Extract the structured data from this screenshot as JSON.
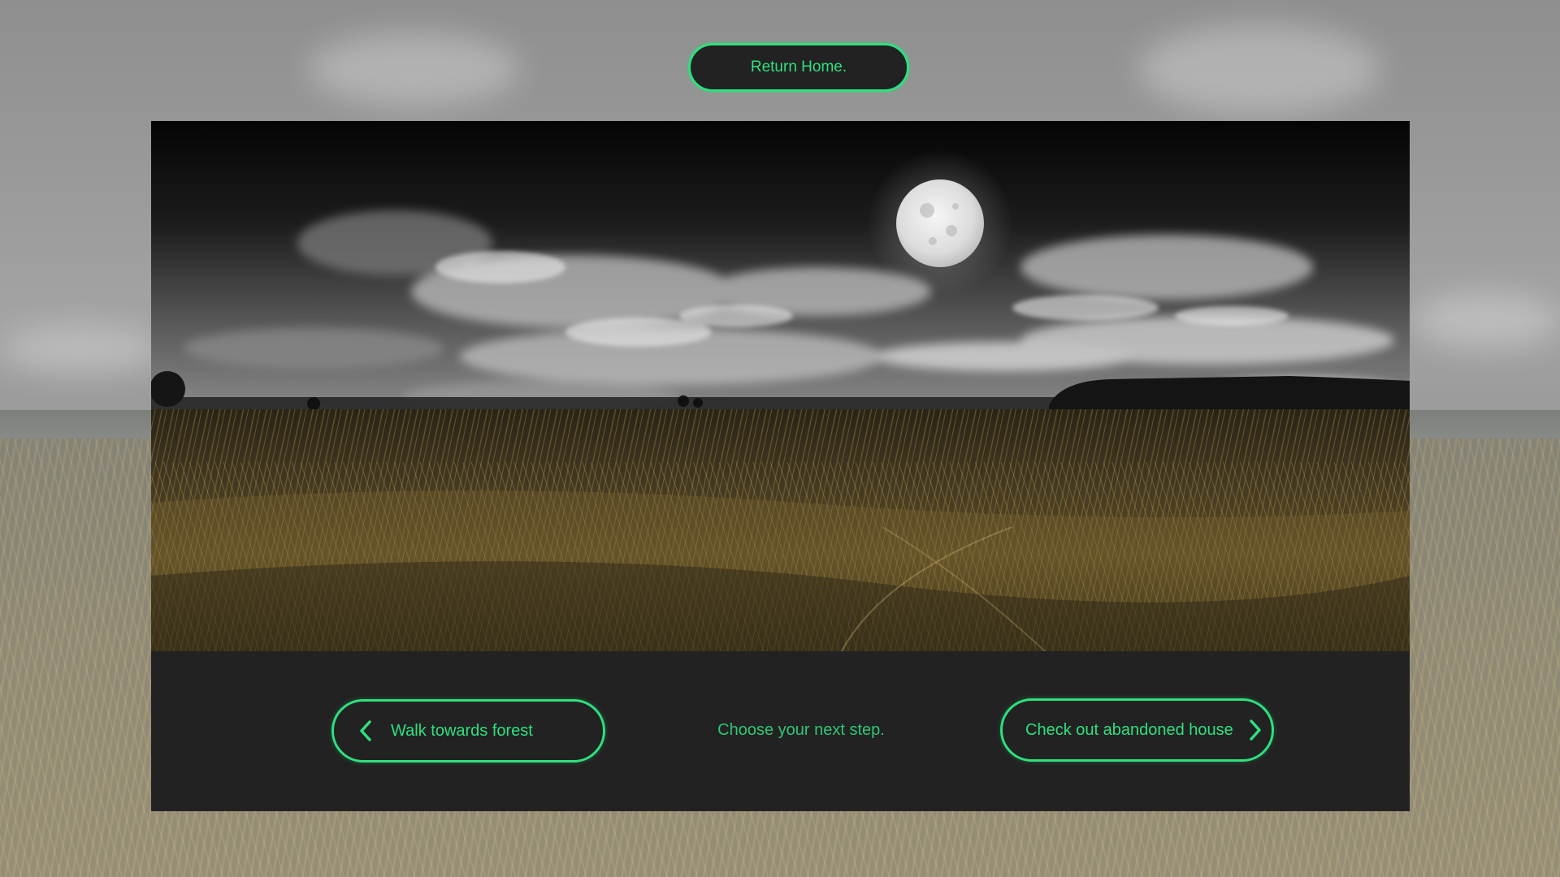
{
  "nav": {
    "home_label": "Return Home."
  },
  "story": {
    "prompt": "Choose your next step."
  },
  "choices": [
    {
      "label": "Walk towards forest",
      "direction": "left"
    },
    {
      "label": "Check out abandoned house",
      "direction": "right"
    }
  ],
  "theme": {
    "accent": "#2ee07f",
    "panel": "#222222",
    "background_overlay": "#9a9a9a"
  },
  "icons": {
    "left": "chevron-left-icon",
    "right": "chevron-right-icon"
  }
}
